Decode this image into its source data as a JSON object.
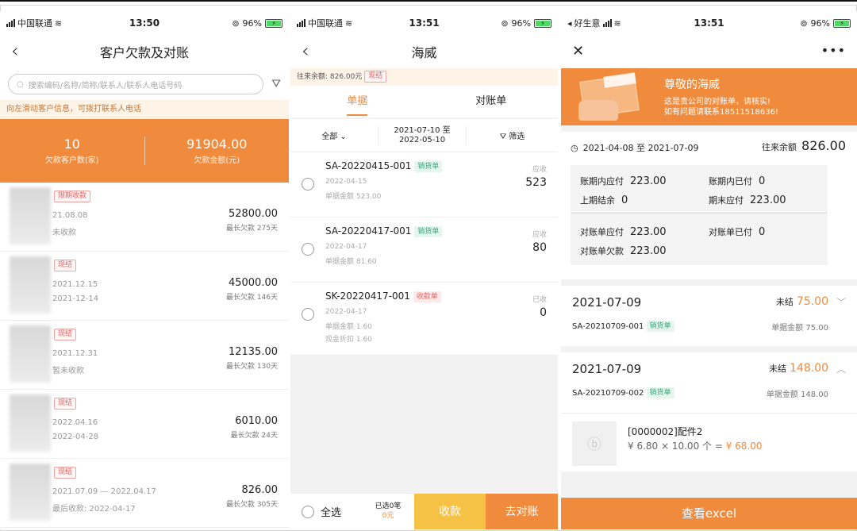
{
  "screen1": {
    "status": {
      "carrier": "中国联通",
      "time": "13:50",
      "battery": "96%"
    },
    "title": "客户欠款及对账",
    "search_placeholder": "搜索编码/名称/简称/联系人/联系人电话号码",
    "hint": "向左滑动客户信息，可拨打联系人电话",
    "summary": {
      "count": "10",
      "count_label": "欠款客户数(家)",
      "amount": "91904.00",
      "amount_label": "欠款金额(元)"
    },
    "customers": [
      {
        "tag": "限期收款",
        "line1": "21.08.08",
        "line2": "未收款",
        "amount": "52800.00",
        "sub": "最长欠款 275天"
      },
      {
        "tag": "现结",
        "line1": "2021.12.15",
        "line2": "2021-12-14",
        "amount": "45000.00",
        "sub": "最长欠款 146天"
      },
      {
        "tag": "现结",
        "line1": "2021.12.31",
        "line2": "暂未收款",
        "amount": "12135.00",
        "sub": "最长欠款 130天"
      },
      {
        "tag": "现结",
        "line1": "2022.04.16",
        "line2": "2022-04-28",
        "amount": "6010.00",
        "sub": "最长欠款 24天"
      },
      {
        "tag": "现结",
        "line1": "2021.07.09 — 2022.04.17",
        "line2": "最后收款: 2022-04-17",
        "amount": "826.00",
        "sub": "最长欠款 305天"
      }
    ]
  },
  "screen2": {
    "status": {
      "carrier": "中国联通",
      "time": "13:51",
      "battery": "96%"
    },
    "title": "海威",
    "balance": "往来余额: 826.00元",
    "balance_tag": "现结",
    "tabs": [
      "单据",
      "对账单"
    ],
    "filter": {
      "all": "全部",
      "date_from": "2021-07-10 至",
      "date_to": "2022-05-10",
      "screen": "筛选"
    },
    "docs": [
      {
        "code": "SA-20220415-001",
        "tag": "销货单",
        "tag_kind": "green",
        "date": "2022-04-15",
        "meta1": "单据金额 523.00",
        "meta2": "",
        "kind": "应收",
        "value": "523"
      },
      {
        "code": "SA-20220417-001",
        "tag": "销货单",
        "tag_kind": "green",
        "date": "2022-04-17",
        "meta1": "单据金额 81.60",
        "meta2": "",
        "kind": "应收",
        "value": "80"
      },
      {
        "code": "SK-20220417-001",
        "tag": "收款单",
        "tag_kind": "pink",
        "date": "2022-04-17",
        "meta1": "单据金额 1.60",
        "meta2": "现金折扣 1.60",
        "kind": "已收",
        "value": "0"
      }
    ],
    "bottom": {
      "select_all": "全选",
      "selected": "已选0笔",
      "selected_amount": "0元",
      "collect": "收款",
      "reconcile": "去对账"
    }
  },
  "screen3": {
    "status": {
      "app": "好生意",
      "time": "13:51",
      "battery": "96%"
    },
    "banner_title": "尊敬的海威",
    "banner_text1": "这是贵公司的对账单，请核实!",
    "banner_text2": "如有问题请联系18511518636!",
    "period": "2021-04-08 至 2021-07-09",
    "balance_label": "往来余额",
    "balance": "826.00",
    "stats": {
      "k1": "账期内应付",
      "v1": "223.00",
      "k2": "账期内已付",
      "v2": "0",
      "k3": "上期结余",
      "v3": "0",
      "k4": "期末应付",
      "v4": "223.00",
      "k5": "对账单应付",
      "v5": "223.00",
      "k6": "对账单已付",
      "v6": "0",
      "k7": "对账单欠款",
      "v7": "223.00"
    },
    "entries": [
      {
        "date": "2021-07-09",
        "status": "未结",
        "amount": "75.00",
        "code": "SA-20210709-001",
        "tag": "销货单",
        "money": "单据金额 75.00"
      },
      {
        "date": "2021-07-09",
        "status": "未结",
        "amount": "148.00",
        "code": "SA-20210709-002",
        "tag": "销货单",
        "money": "单据金额 148.00"
      }
    ],
    "item": {
      "name": "[0000002]配件2",
      "calc": "¥ 6.80 × 10.00 个 = ",
      "total": "¥ 68.00"
    },
    "excel": "查看excel"
  }
}
